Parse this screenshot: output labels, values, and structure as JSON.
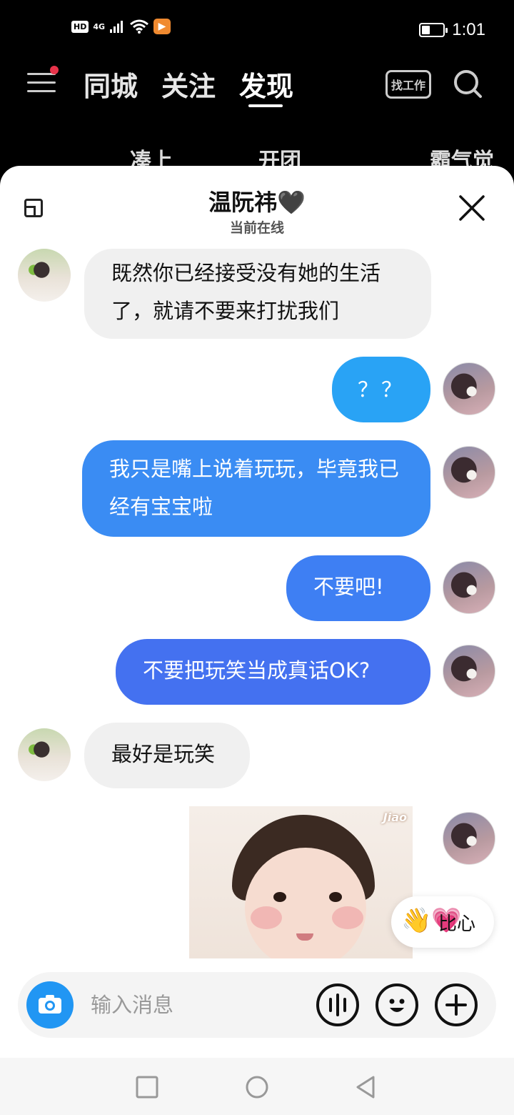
{
  "status_bar": {
    "hd": "HD",
    "network": "4G",
    "time": "1:01",
    "battery_level": 0.4
  },
  "top_nav": {
    "tabs": [
      "同城",
      "关注",
      "发现"
    ],
    "active_tab": "发现",
    "job_button": "找工作",
    "icons": [
      "menu-icon",
      "search-icon"
    ]
  },
  "sub_tabs": [
    "凑上",
    "开团",
    "霸气觉得"
  ],
  "chat": {
    "contact_name": "温阮祎🖤",
    "contact_status": "当前在线",
    "messages": [
      {
        "side": "in",
        "text": "既然你已经接受没有她的生活了，就请不要来打扰我们"
      },
      {
        "side": "out",
        "text": "？？",
        "color": "#29a3f5"
      },
      {
        "side": "out",
        "text": "我只是嘴上说着玩玩，毕竟我已经有宝宝啦",
        "color": "#3a8cf3"
      },
      {
        "side": "out",
        "text": "不要吧!",
        "color": "#3e7ff3"
      },
      {
        "side": "out",
        "text": "不要把玩笑当成真话OK?",
        "color": "#4471f0"
      },
      {
        "side": "in",
        "text": "最好是玩笑"
      },
      {
        "side": "out",
        "type": "image",
        "tag": "Jiao"
      }
    ],
    "quick_reply": {
      "emoji": "👋💗",
      "label": "比心"
    },
    "input": {
      "placeholder": "输入消息"
    }
  },
  "icons": [
    "minimize-icon",
    "close-icon",
    "camera-icon",
    "voice-icon",
    "emoji-icon",
    "plus-icon",
    "recent-apps-icon",
    "home-icon",
    "back-icon"
  ]
}
